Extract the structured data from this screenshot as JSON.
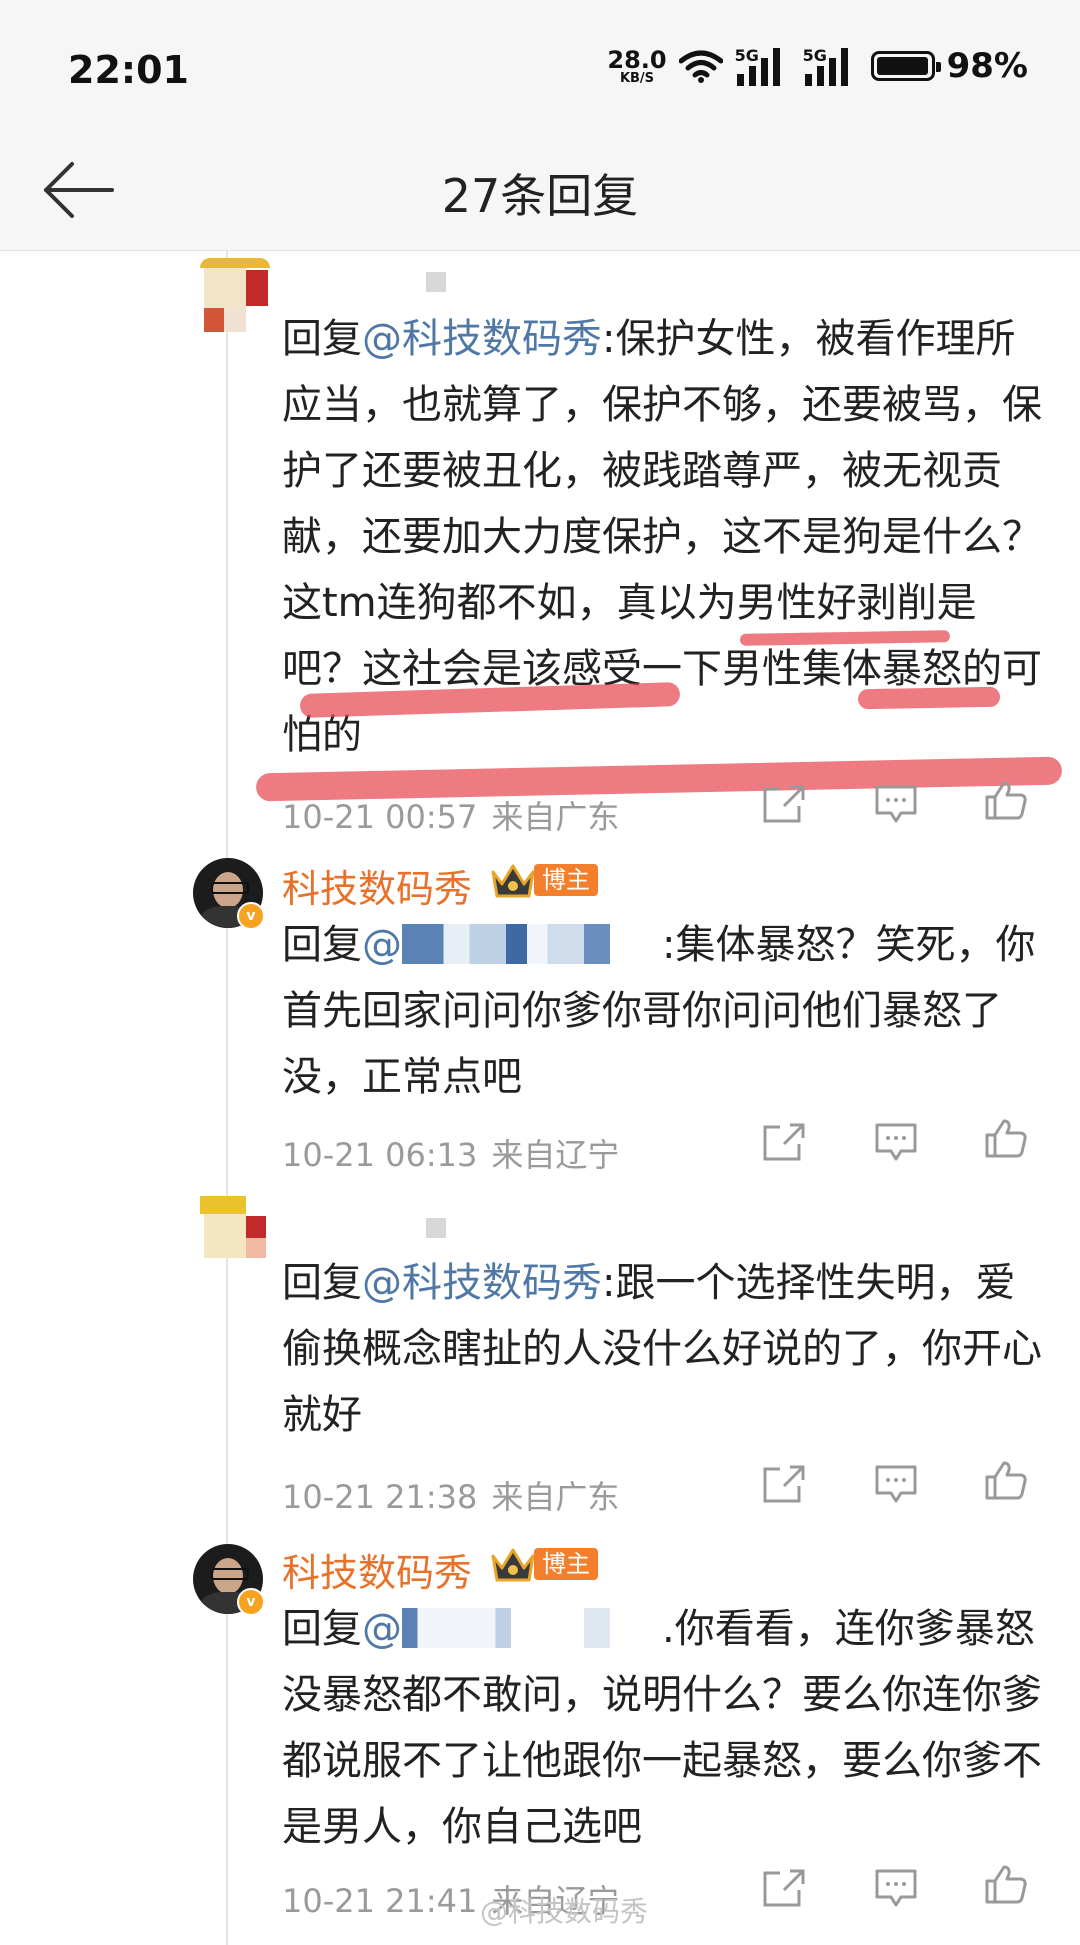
{
  "status_bar": {
    "time": "22:01",
    "net_speed": "28.0",
    "net_unit": "KB/S",
    "sig1": "5G",
    "sig2": "5G",
    "battery": "98%"
  },
  "header": {
    "title": "27条回复"
  },
  "comments": [
    {
      "reply_prefix": "回复",
      "mention": "@科技数码秀",
      "text": ":保护女性，被看作理所应当，也就算了，保护不够，还要被骂，保护了还要被丑化，被践踏尊严，被无视贡献，还要加大力度保护，这不是狗是什么？这tm连狗都不如，真以为男性好剥削是吧？这社会是该感受一下男性集体暴怒的可怕的",
      "time": "10-21 00:57",
      "location": "来自广东"
    },
    {
      "username": "科技数码秀",
      "badge": "博主",
      "reply_prefix": "回复",
      "mention": "@",
      "text": ":集体暴怒？笑死，你首先回家问问你爹你哥你问问他们暴怒了没，正常点吧",
      "time": "10-21 06:13",
      "location": "来自辽宁"
    },
    {
      "reply_prefix": "回复",
      "mention": "@科技数码秀",
      "text": ":跟一个选择性失明，爱偷换概念瞎扯的人没什么好说的了，你开心就好",
      "time": "10-21 21:38",
      "location": "来自广东"
    },
    {
      "username": "科技数码秀",
      "badge": "博主",
      "reply_prefix": "回复",
      "mention": "@",
      "text": ".你看看，连你爹暴怒没暴怒都不敢问，说明什么？要么你连你爹都说服不了让他跟你一起暴怒，要么你爹不是男人，你自己选吧",
      "time": "10-21 21:41",
      "location": "来自辽宁"
    }
  ],
  "watermark": "@科技数码秀",
  "colors": {
    "mention": "#4f78a7",
    "username": "#e8722a",
    "badge": "#f37f2d",
    "highlight": "#e84652"
  }
}
